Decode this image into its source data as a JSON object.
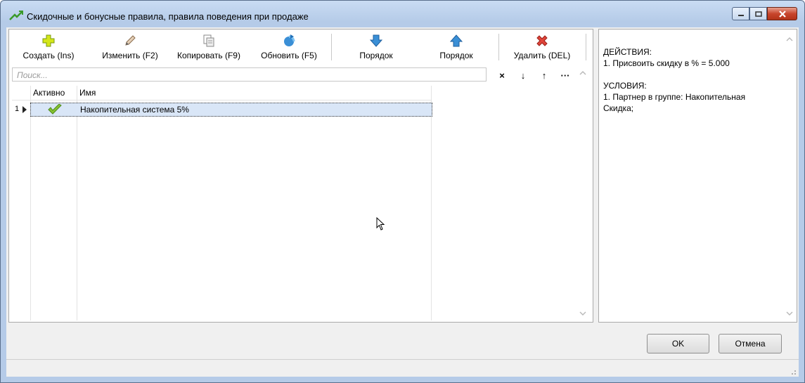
{
  "window": {
    "title": "Скидочные и бонусные правила, правила поведения при продаже",
    "colors": {
      "close": "#c8452c",
      "selection": "#d9e6f7",
      "check": "#78b428"
    }
  },
  "toolbar": {
    "create": {
      "label": "Создать (Ins)",
      "icon": "plus-icon"
    },
    "edit": {
      "label": "Изменить (F2)",
      "icon": "pencil-icon"
    },
    "copy": {
      "label": "Копировать (F9)",
      "icon": "copy-icon"
    },
    "refresh": {
      "label": "Обновить (F5)",
      "icon": "refresh-icon"
    },
    "order_down": {
      "label": "Порядок",
      "icon": "arrow-down-icon"
    },
    "order_up": {
      "label": "Порядок",
      "icon": "arrow-up-icon"
    },
    "delete": {
      "label": "Удалить (DEL)",
      "icon": "delete-icon"
    }
  },
  "search": {
    "placeholder": "Поиск...",
    "tools": [
      "×",
      "↓",
      "↑",
      "···"
    ]
  },
  "grid": {
    "columns": [
      "Активно",
      "Имя"
    ],
    "rows": [
      {
        "num": "1",
        "active": true,
        "name": "Накопительная система 5%"
      }
    ]
  },
  "details": {
    "actions_header": "ДЕЙСТВИЯ:",
    "actions_line": "1. Присвоить скидку в % = 5.000",
    "conditions_header": "УСЛОВИЯ:",
    "conditions_line1": "1. Партнер в группе: Накопительная",
    "conditions_line2": "Скидка;"
  },
  "buttons": {
    "ok": "OK",
    "cancel": "Отмена"
  }
}
